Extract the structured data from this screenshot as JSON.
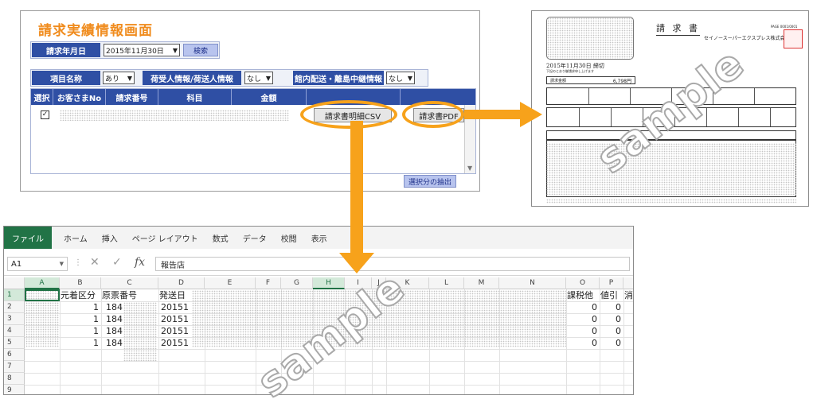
{
  "web_form": {
    "title": "請求実績情報画面",
    "date_label": "請求年月日",
    "date_value": "2015年11月30日",
    "search_label": "検索",
    "item_name_label": "項目名称",
    "item_name_value": "あり",
    "shipper_info_label": "荷受人情報/荷送人情報",
    "shipper_info_value": "なし",
    "island_label": "館内配送・離島中継情報",
    "island_value": "なし",
    "columns": [
      "選択",
      "お客さまNo",
      "請求番号",
      "科目",
      "金額"
    ],
    "checkbox_mark": "✓",
    "csv_button": "請求書明細CSV",
    "pdf_button": "請求書PDF",
    "extract_button": "選択分の抽出"
  },
  "invoice": {
    "title": "請 求 書",
    "page_no": "PAGE 0001/0001",
    "company": "セイノースーパーエクスプレス株式会社",
    "closing_date": "2015年11月30日 締切",
    "note": "下記のとおり御請求申し上げます",
    "amount_label": "請求金額",
    "amount": "6,798円"
  },
  "excel": {
    "ribbon_tabs": [
      "ファイル",
      "ホーム",
      "挿入",
      "ページ レイアウト",
      "数式",
      "データ",
      "校閲",
      "表示"
    ],
    "name_box": "A1",
    "formula_value": "報告店",
    "columns": [
      "A",
      "B",
      "C",
      "D",
      "E",
      "F",
      "G",
      "H",
      "I",
      "J",
      "K",
      "L",
      "M",
      "N",
      "O",
      "P"
    ],
    "rows": [
      "1",
      "2",
      "3",
      "4",
      "5",
      "6",
      "7",
      "8",
      "9"
    ],
    "headers": {
      "B": "元着区分",
      "C": "原票番号",
      "D": "発送日",
      "O": "課税他",
      "P": "値引",
      "Q": "消"
    },
    "data_rows": [
      {
        "B": "1",
        "C": "184",
        "D": "20151",
        "O": "0",
        "P": "0"
      },
      {
        "B": "1",
        "C": "184",
        "D": "20151",
        "O": "0",
        "P": "0"
      },
      {
        "B": "1",
        "C": "184",
        "D": "20151",
        "O": "0",
        "P": "0"
      },
      {
        "B": "1",
        "C": "184",
        "D": "20151",
        "O": "0",
        "P": "0"
      }
    ]
  },
  "watermarks": [
    "sample",
    "sample"
  ],
  "colors": {
    "accent_orange": "#f7a21b",
    "header_blue": "#2f4fa4",
    "excel_green": "#217346"
  }
}
